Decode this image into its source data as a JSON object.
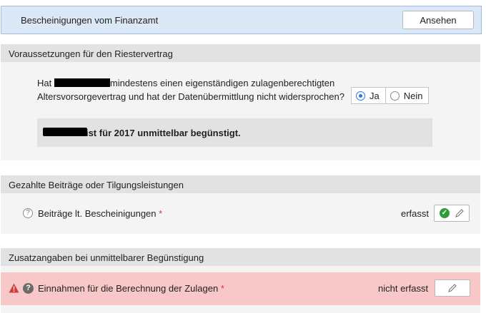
{
  "banner": {
    "title": "Bescheinigungen vom Finanzamt",
    "button_label": "Ansehen"
  },
  "section1": {
    "header": "Voraussetzungen für den Riestervertrag",
    "question_prefix": "Hat",
    "question_line1_rest": "mindestens einen eigenständigen zulagenberechtigten",
    "question_line2": "Altersvorsorgevertrag und hat der Datenübermittlung nicht widersprochen?",
    "options": [
      {
        "label": "Ja",
        "selected": true
      },
      {
        "label": "Nein",
        "selected": false
      }
    ],
    "info_text": "Christine ist für 2017 unmittelbar begünstigt."
  },
  "section2": {
    "header": "Gezahlte Beiträge oder Tilgungsleistungen",
    "row_label": "Beiträge lt. Bescheinigungen",
    "required_mark": "*",
    "status": "erfasst"
  },
  "section3": {
    "header": "Zusatzangaben bei unmittelbarer Begünstigung",
    "row_label": "Einnahmen für die Berechnung der Zulagen",
    "required_mark": "*",
    "status": "nicht erfasst"
  },
  "colors": {
    "banner_bg": "#dbe8f7",
    "section_header_bg": "#e2e2e2",
    "warning_row_bg": "#f8c8c8",
    "radio_accent": "#2b78d6",
    "success_green": "#2e9e3c",
    "warning_red": "#d33b3b"
  }
}
